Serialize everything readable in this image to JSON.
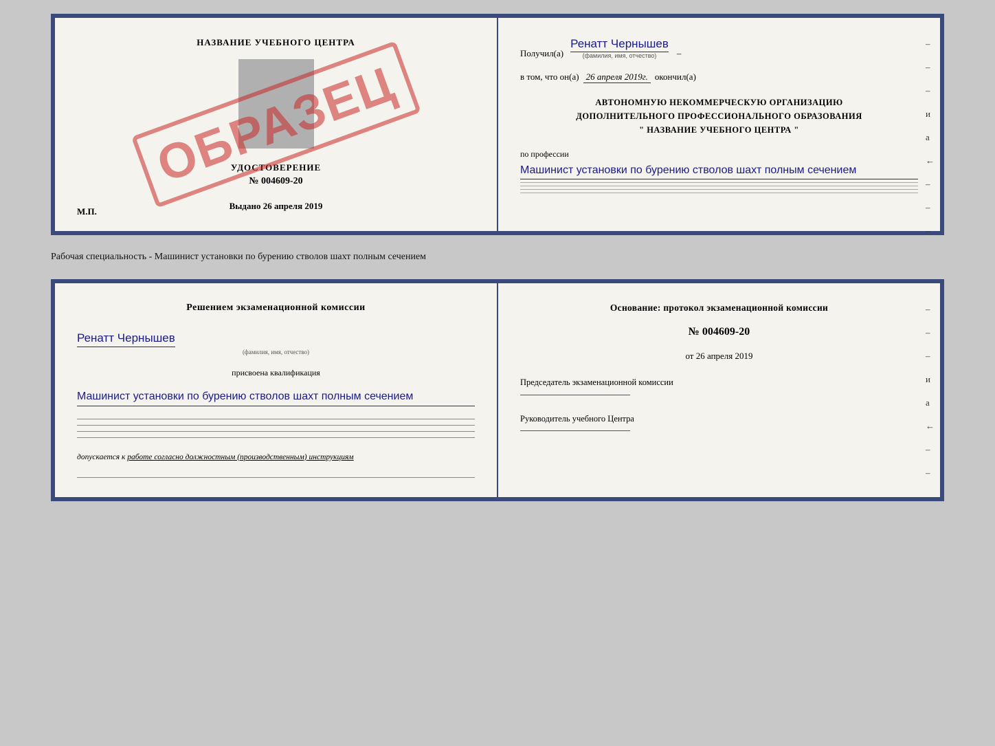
{
  "page": {
    "background_color": "#c8c8c8"
  },
  "top_doc": {
    "left": {
      "center_title": "НАЗВАНИЕ УЧЕБНОГО ЦЕНТРА",
      "stamp_text": "ОБРАЗЕЦ",
      "udostoverenie_title": "УДОСТОВЕРЕНИЕ",
      "udostoverenie_num": "№ 004609-20",
      "vydano_label": "Выдано",
      "vydano_date": "26 апреля 2019",
      "mp_label": "М.П."
    },
    "right": {
      "poluchil_label": "Получил(а)",
      "poluchil_name": "Ренатт Чернышев",
      "fio_caption": "(фамилия, имя, отчество)",
      "vtom_label": "в том, что он(а)",
      "vtom_date": "26 апреля 2019г.",
      "okonchil_label": "окончил(а)",
      "org_line1": "АВТОНОМНУЮ НЕКОММЕРЧЕСКУЮ ОРГАНИЗАЦИЮ",
      "org_line2": "ДОПОЛНИТЕЛЬНОГО ПРОФЕССИОНАЛЬНОГО ОБРАЗОВАНИЯ",
      "org_line3": "\"     НАЗВАНИЕ УЧЕБНОГО ЦЕНТРА     \"",
      "po_professii_label": "по профессии",
      "professiya_name": "Машинист установки по бурению стволов шахт полным сечением",
      "dashes": [
        "–",
        "–",
        "–",
        "и",
        "а",
        "←",
        "–",
        "–",
        "–"
      ]
    }
  },
  "specialty_label": "Рабочая специальность - Машинист установки по бурению стволов шахт полным сечением",
  "bottom_doc": {
    "left": {
      "resheniem_title": "Решением экзаменационной комиссии",
      "person_name": "Ренатт Чернышев",
      "fio_caption": "(фамилия, имя, отчество)",
      "prisvoena_label": "присвоена квалификация",
      "qualification": "Машинист установки по бурению стволов шахт полным сечением",
      "dopuskaetsya_text": "допускается к",
      "dopuskaetsya_underline": "работе согласно должностным (производственным) инструкциям"
    },
    "right": {
      "osnovanie_title": "Основание: протокол экзаменационной комиссии",
      "protocol_num": "№  004609-20",
      "ot_label": "от",
      "ot_date": "26 апреля 2019",
      "predsedatel_title": "Председатель экзаменационной комиссии",
      "rukovoditel_title": "Руководитель учебного Центра",
      "dashes": [
        "–",
        "–",
        "–",
        "и",
        "а",
        "←",
        "–",
        "–"
      ]
    }
  }
}
